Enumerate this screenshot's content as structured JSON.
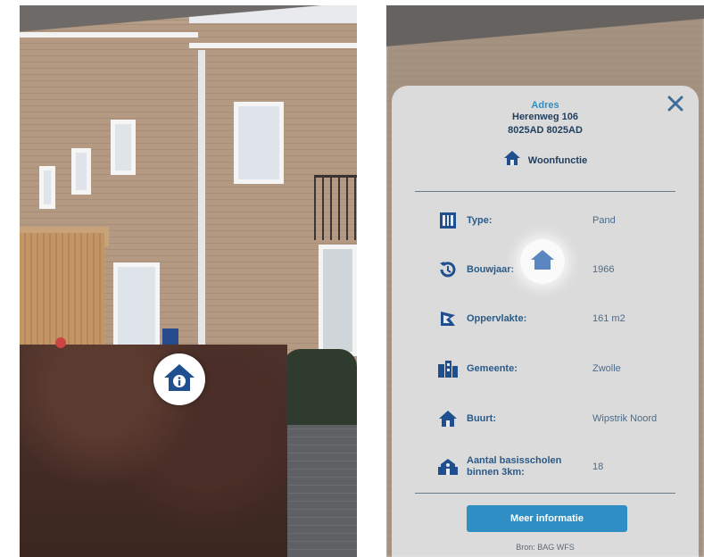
{
  "left_screen": {
    "poi_marker_icon": "house-info-icon"
  },
  "info_panel": {
    "header_label": "Adres",
    "address_line1": "Herenweg 106",
    "address_line2": "8025AD 8025AD",
    "function_icon": "house-icon",
    "function_text": "Woonfunctie",
    "close_icon": "close-icon",
    "attributes": [
      {
        "icon": "building-columns-icon",
        "label": "Type:",
        "value": "Pand"
      },
      {
        "icon": "history-icon",
        "label": "Bouwjaar:",
        "value": "1966"
      },
      {
        "icon": "area-icon",
        "label": "Oppervlakte:",
        "value": "161 m2"
      },
      {
        "icon": "buildings-icon",
        "label": "Gemeente:",
        "value": "Zwolle"
      },
      {
        "icon": "home-icon",
        "label": "Buurt:",
        "value": "Wipstrik Noord"
      },
      {
        "icon": "school-icon",
        "label": "Aantal basisscholen binnen 3km:",
        "value": "18"
      }
    ],
    "more_button_label": "Meer informatie",
    "footer_text": "Bron: BAG WFS"
  },
  "colors": {
    "accent": "#2f8fc4",
    "navy": "#1f3d5c",
    "marker_blue": "#1f4f8f"
  }
}
